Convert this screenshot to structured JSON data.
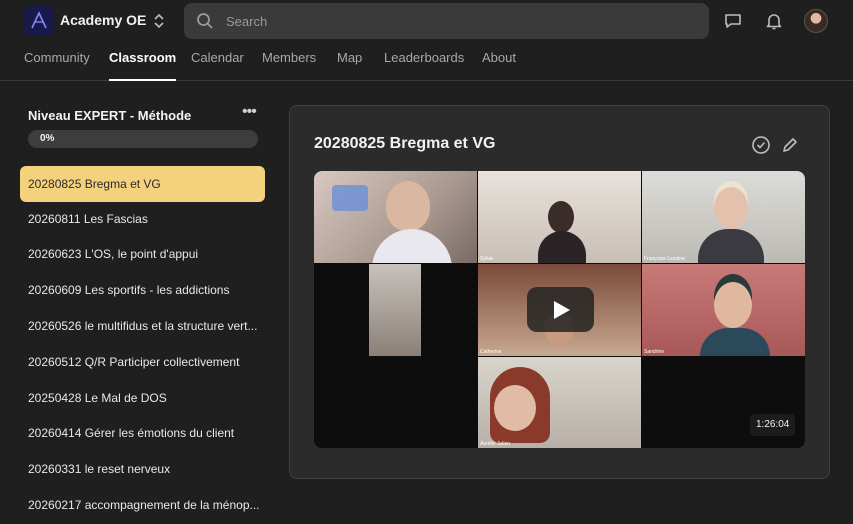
{
  "header": {
    "app_name": "Academy OE",
    "logo_text": "Academy OE",
    "search_placeholder": "Search",
    "icons": [
      "chat-icon",
      "bell-icon"
    ]
  },
  "nav": {
    "tabs": [
      {
        "label": "Community",
        "active": false
      },
      {
        "label": "Classroom",
        "active": true
      },
      {
        "label": "Calendar",
        "active": false
      },
      {
        "label": "Members",
        "active": false
      },
      {
        "label": "Map",
        "active": false
      },
      {
        "label": "Leaderboards",
        "active": false
      },
      {
        "label": "About",
        "active": false
      }
    ]
  },
  "sidebar": {
    "course_title": "Niveau EXPERT - Méthode",
    "progress_label": "0%",
    "progress_value": 0,
    "lessons": [
      {
        "title": "20280825 Bregma et VG",
        "active": true
      },
      {
        "title": "20260811 Les Fascias",
        "active": false
      },
      {
        "title": "20260623 L'OS, le point d'appui",
        "active": false
      },
      {
        "title": "20260609 Les sportifs - les addictions",
        "active": false
      },
      {
        "title": "20260526 le multifidus et la structure vert...",
        "active": false
      },
      {
        "title": "20260512 Q/R Participer collectivement",
        "active": false
      },
      {
        "title": "20250428 Le Mal de DOS",
        "active": false
      },
      {
        "title": "20260414 Gérer les émotions du client",
        "active": false
      },
      {
        "title": "20260331 le reset nerveux",
        "active": false
      },
      {
        "title": "20260217 accompagnement de la ménop...",
        "active": false
      }
    ]
  },
  "main": {
    "lesson_title": "20280825 Bregma et VG",
    "video": {
      "duration": "1:26:04",
      "participants": [
        "Sylvie",
        "Françoise Lesoine",
        "Catherine",
        "Sandrine",
        "Aurélie Julien"
      ]
    }
  },
  "colors": {
    "accent": "#f4d17c",
    "background": "#1f1f1f",
    "panel": "#2b2b2b"
  }
}
